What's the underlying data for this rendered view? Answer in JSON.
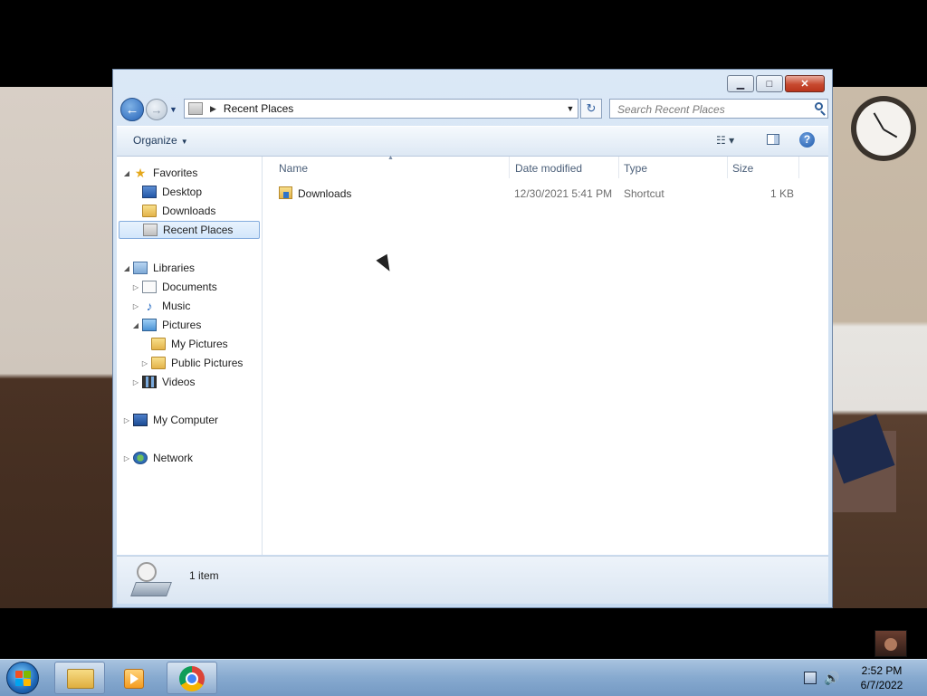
{
  "window": {
    "controls": {
      "minimize": "▁",
      "maximize": "□",
      "close": "✕"
    }
  },
  "nav": {
    "back_label": "←",
    "forward_label": "→",
    "history_dropdown": "▼",
    "address_separator": "▶",
    "address_text": "Recent Places",
    "address_dropdown": "▼",
    "refresh_label": "↻",
    "search_placeholder": "Search Recent Places"
  },
  "toolbar": {
    "organize_label": "Organize",
    "organize_caret": "▼",
    "views_label": "☷ ▾",
    "help_label": "?"
  },
  "sidebar": {
    "favorites": {
      "label": "Favorites",
      "expander": "◢"
    },
    "favorites_items": [
      {
        "label": "Desktop"
      },
      {
        "label": "Downloads"
      },
      {
        "label": "Recent Places",
        "selected": true
      }
    ],
    "libraries": {
      "label": "Libraries",
      "expander": "◢"
    },
    "libraries_items": [
      {
        "label": "Documents",
        "expander": "▷"
      },
      {
        "label": "Music",
        "expander": "▷"
      },
      {
        "label": "Pictures",
        "expander": "◢"
      },
      {
        "label": "My Pictures",
        "expander": ""
      },
      {
        "label": "Public Pictures",
        "expander": "▷"
      },
      {
        "label": "Videos",
        "expander": "▷"
      }
    ],
    "computer": {
      "label": "My Computer",
      "expander": "▷"
    },
    "network": {
      "label": "Network",
      "expander": "▷"
    },
    "favorites_star": "★",
    "music_glyph": "♪"
  },
  "content": {
    "columns": [
      "Name",
      "Date modified",
      "Type",
      "Size"
    ],
    "sort_indicator": "▲",
    "rows": [
      {
        "name": "Downloads",
        "date_modified": "12/30/2021 5:41 PM",
        "type": "Shortcut",
        "size": "1 KB"
      }
    ]
  },
  "details": {
    "item_count": "1 item"
  },
  "taskbar": {
    "tray_volume": "🔊",
    "clock": {
      "time": "2:52 PM",
      "date": "6/7/2022"
    }
  },
  "colors": {
    "selection": "#d2e6fb",
    "close_button": "#c7492f",
    "taskbar": "#86a9cf"
  }
}
